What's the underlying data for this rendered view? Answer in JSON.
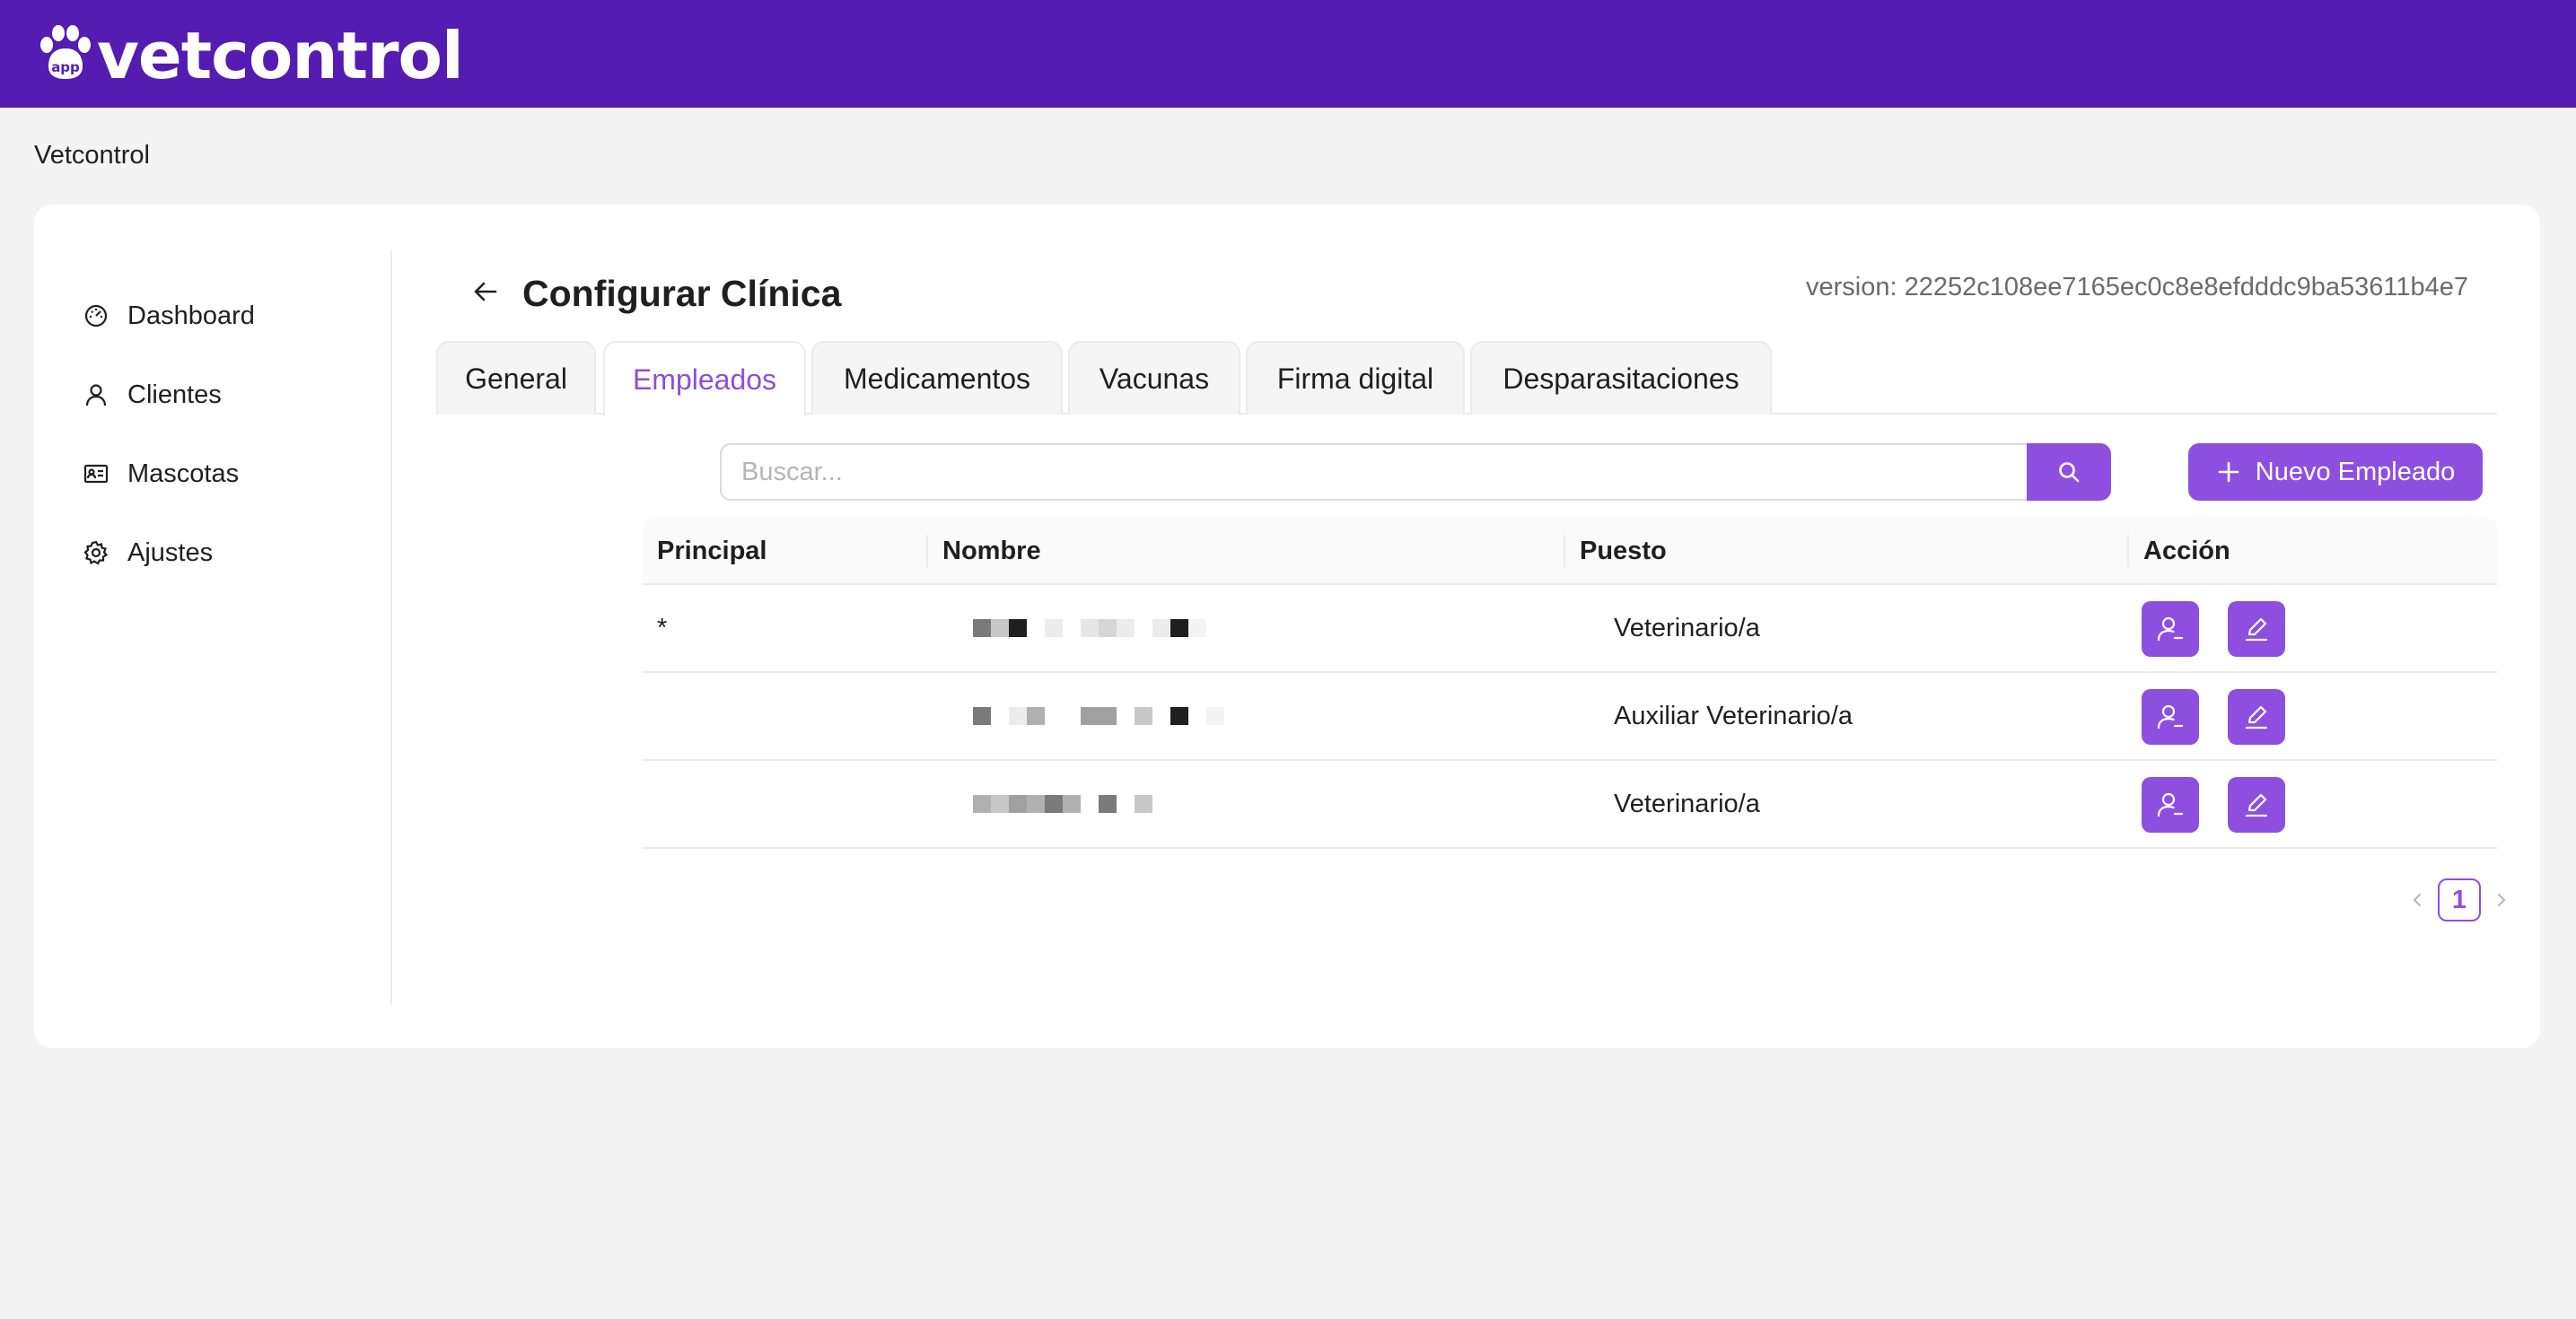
{
  "header": {
    "logo_badge": "app",
    "logo_text": "vetcontrol"
  },
  "site_label": "Vetcontrol",
  "sidebar": {
    "items": [
      {
        "label": "Dashboard",
        "icon": "dashboard-gauge-icon"
      },
      {
        "label": "Clientes",
        "icon": "user-icon"
      },
      {
        "label": "Mascotas",
        "icon": "id-card-icon"
      },
      {
        "label": "Ajustes",
        "icon": "gear-icon"
      }
    ]
  },
  "main": {
    "title": "Configurar Clínica",
    "version": "version: 22252c108ee7165ec0c8e8efdddc9ba53611b4e7",
    "tabs": [
      {
        "label": "General"
      },
      {
        "label": "Empleados"
      },
      {
        "label": "Medicamentos"
      },
      {
        "label": "Vacunas"
      },
      {
        "label": "Firma digital"
      },
      {
        "label": "Desparasitaciones"
      }
    ],
    "active_tab": "Empleados",
    "search": {
      "placeholder": "Buscar...",
      "value": ""
    },
    "new_button_label": "Nuevo Empleado",
    "table": {
      "columns": [
        "Principal",
        "Nombre",
        "Puesto",
        "Acción"
      ],
      "rows": [
        {
          "principal": "*",
          "nombre": "[redacted]",
          "puesto": "Veterinario/a"
        },
        {
          "principal": "",
          "nombre": "[redacted]",
          "puesto": "Auxiliar Veterinario/a"
        },
        {
          "principal": "",
          "nombre": "[redacted]",
          "puesto": "Veterinario/a"
        }
      ]
    },
    "pagination": {
      "current_page": "1"
    }
  },
  "colors": {
    "header_bg": "#541cb0",
    "accent": "#8e4fe0",
    "page_bg": "#f4f4f4"
  }
}
